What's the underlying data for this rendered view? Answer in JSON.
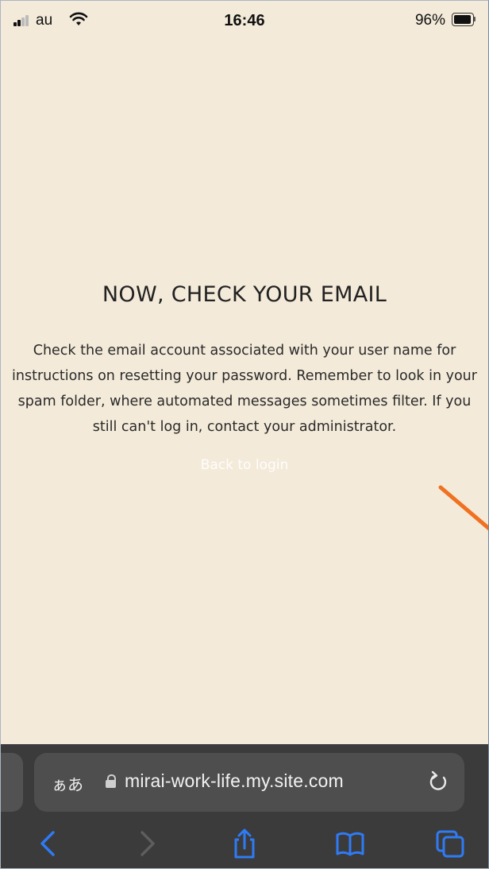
{
  "status_bar": {
    "carrier": "au",
    "time": "16:46",
    "battery_percent": "96%",
    "battery_level": 0.96
  },
  "page": {
    "heading": "NOW, CHECK YOUR EMAIL",
    "message": "Check the email account associated with your user name for instructions on resetting your password. Remember to look in your spam folder, where automated messages sometimes filter. If you still can't log in, contact your administrator.",
    "back_link": "Back to login"
  },
  "browser": {
    "text_size_button": "ぁあ",
    "url": "mirai-work-life.my.site.com",
    "toolbar": {
      "back": "back-icon",
      "forward": "forward-icon",
      "share": "share-icon",
      "bookmarks": "book-icon",
      "tabs": "tabs-icon"
    }
  },
  "colors": {
    "page_background": "#f3ead9",
    "annotation_arrow": "#f07121",
    "safari_accent": "#2f7bf5"
  }
}
